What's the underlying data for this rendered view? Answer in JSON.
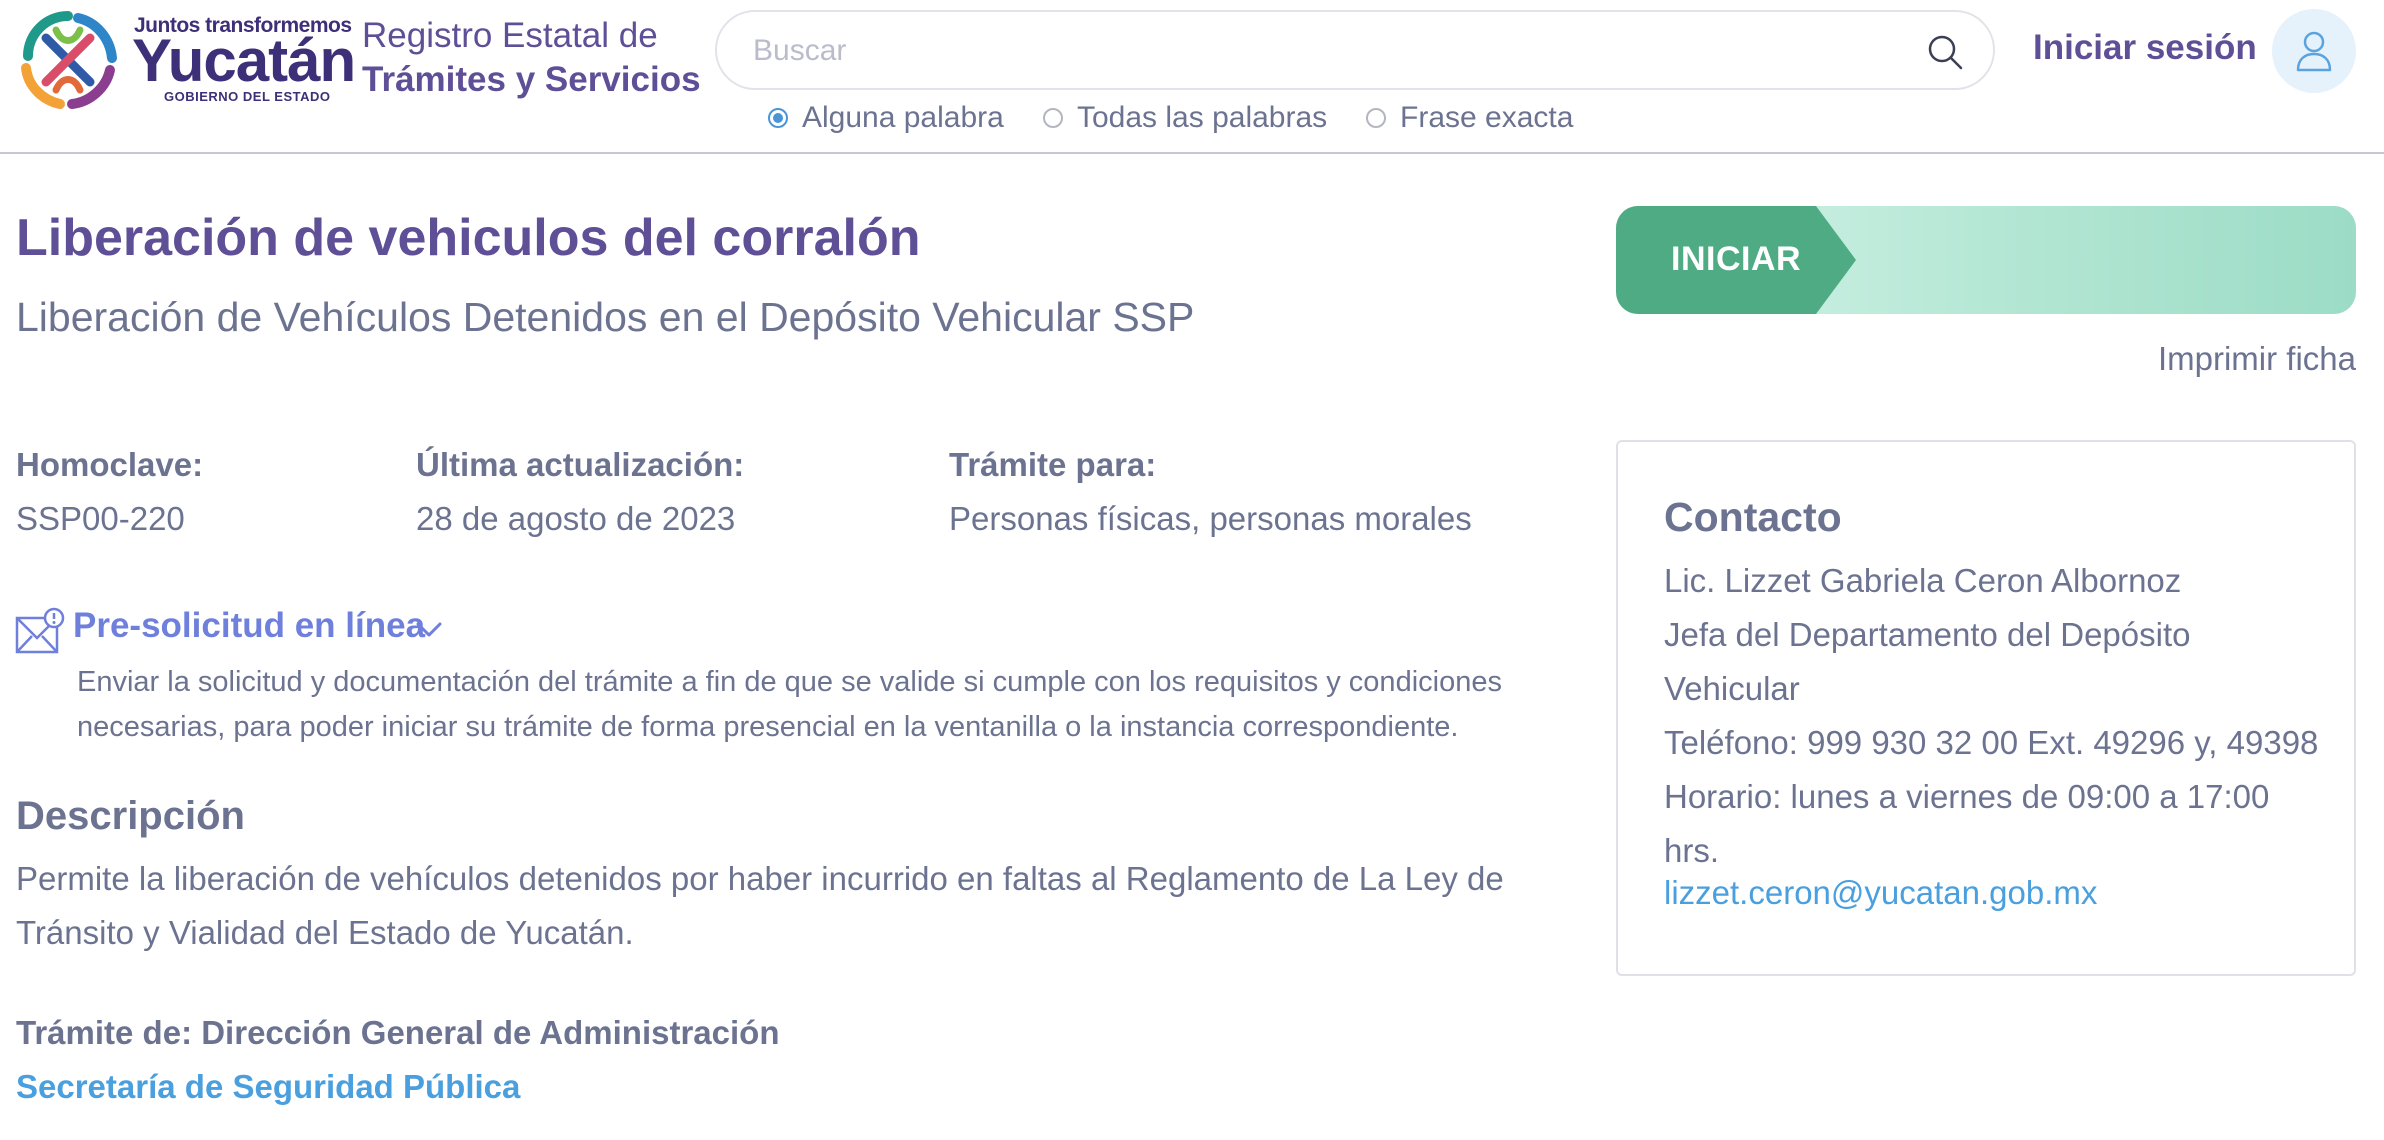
{
  "header": {
    "brand": {
      "tagline": "Juntos transformemos",
      "name": "Yucatán",
      "subtitle": "GOBIERNO DEL ESTADO"
    },
    "registry": {
      "line1": "Registro Estatal de",
      "line2": "Trámites y Servicios"
    },
    "search": {
      "placeholder": "Buscar",
      "value": "",
      "icon": "search-icon",
      "options": [
        {
          "label": "Alguna palabra",
          "selected": true
        },
        {
          "label": "Todas las palabras",
          "selected": false
        },
        {
          "label": "Frase exacta",
          "selected": false
        }
      ]
    },
    "login_label": "Iniciar sesión",
    "avatar_icon": "user-icon"
  },
  "main": {
    "title": "Liberación de vehiculos del corralón",
    "subtitle": "Liberación de Vehículos Detenidos en el Depósito Vehicular SSP",
    "meta": [
      {
        "label": "Homoclave:",
        "value": "SSP00-220"
      },
      {
        "label": "Última actualización:",
        "value": "28 de agosto de 2023"
      },
      {
        "label": "Trámite para:",
        "value": "Personas físicas, personas morales"
      }
    ],
    "pre_solicitud": {
      "icon": "envelope-alert-icon",
      "title": "Pre-solicitud en línea",
      "description": "Enviar la solicitud y documentación del trámite a fin de que se valide si cumple con los requisitos y condiciones necesarias, para poder iniciar su trámite de forma presencial en la ventanilla o la instancia correspondiente."
    },
    "description": {
      "heading": "Descripción",
      "body": "Permite la liberación de vehículos detenidos por haber incurrido en faltas al Reglamento de La Ley de Tránsito y Vialidad del Estado de Yucatán."
    },
    "tramite_de": "Trámite de: Dirección General de Administración",
    "dependency": "Secretaría de Seguridad Pública"
  },
  "sidebar": {
    "start_label": "INICIAR",
    "print_label": "Imprimir ficha",
    "contact": {
      "heading": "Contacto",
      "name": "Lic. Lizzet Gabriela Ceron Albornoz",
      "position": "Jefa del Departamento del Depósito Vehicular",
      "phone": "Teléfono: 999 930 32 00 Ext. 49296 y, 49398",
      "schedule": "Horario: lunes a viernes de 09:00 a 17:00 hrs.",
      "email": "lizzet.ceron@yucatan.gob.mx"
    }
  },
  "colors": {
    "primary_purple": "#5f4f96",
    "text_gray": "#6c7391",
    "link_blue": "#4a9fde",
    "start_green": "#4eab84"
  }
}
